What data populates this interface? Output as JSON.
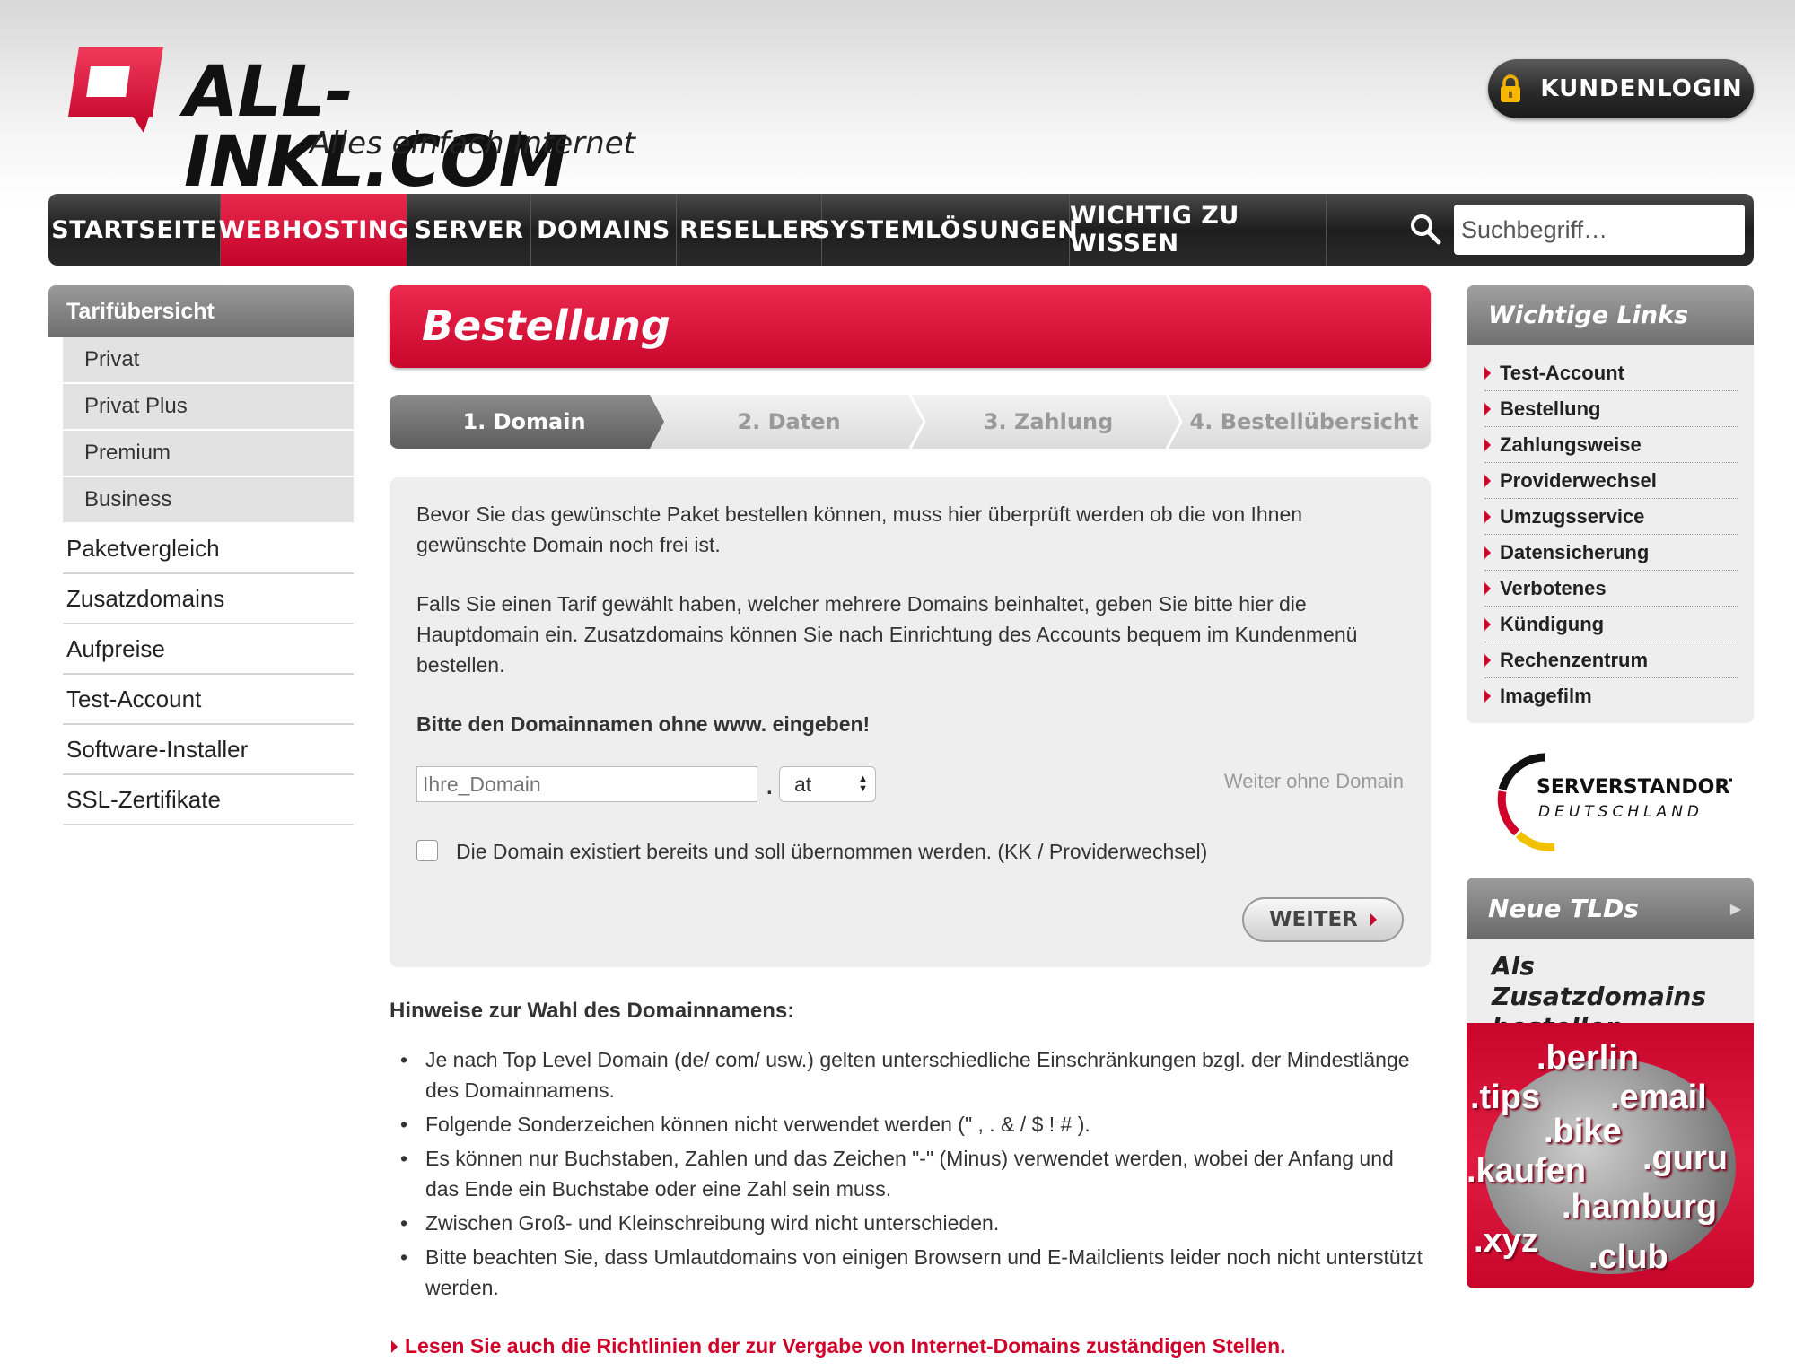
{
  "header": {
    "logo_text": "ALL-INKL.COM",
    "slogan": "Alles einfach Internet",
    "login_label": "KUNDENLOGIN",
    "accent": "#d0022a"
  },
  "nav": {
    "items": [
      "STARTSEITE",
      "WEBHOSTING",
      "SERVER",
      "DOMAINS",
      "RESELLER",
      "SYSTEMLÖSUNGEN",
      "WICHTIG ZU WISSEN"
    ],
    "active": "WEBHOSTING",
    "search_placeholder": "Suchbegriff…"
  },
  "left_sidebar": {
    "title": "Tarifübersicht",
    "sub_items": [
      "Privat",
      "Privat Plus",
      "Premium",
      "Business"
    ],
    "items": [
      "Paketvergleich",
      "Zusatzdomains",
      "Aufpreise",
      "Test-Account",
      "Software-Installer",
      "SSL-Zertifikate"
    ]
  },
  "main": {
    "title": "Bestellung",
    "steps": [
      "1. Domain",
      "2. Daten",
      "3. Zahlung",
      "4. Bestellübersicht"
    ],
    "active_step": 0,
    "intro_1": "Bevor Sie das gewünschte Paket bestellen können, muss hier überprüft werden ob die von Ihnen gewünschte Domain noch frei ist.",
    "intro_2": "Falls Sie einen Tarif gewählt haben, welcher mehrere Domains beinhaltet, geben Sie bitte hier die Hauptdomain ein. Zusatzdomains können Sie nach Einrichtung des Accounts bequem im Kundenmenü bestellen.",
    "instruction": "Bitte den Domainnamen ohne www. eingeben!",
    "domain_placeholder": "Ihre_Domain",
    "dot": ".",
    "tld_selected": "at",
    "skip_link": "Weiter ohne Domain",
    "checkbox_label": "Die Domain existiert bereits und soll übernommen werden. (KK / Providerwechsel)",
    "button_label": "WEITER",
    "hints_title": "Hinweise zur Wahl des Domainnamens:",
    "hints": [
      "Je nach Top Level Domain (de/ com/ usw.) gelten unterschiedliche Einschränkungen bzgl. der Mindestlänge des Domainnamens.",
      "Folgende Sonderzeichen können nicht verwendet werden (\" , . & / $ ! # ).",
      "Es können nur Buchstaben, Zahlen und das Zeichen \"-\" (Minus) verwendet werden, wobei der Anfang und das Ende ein Buchstabe oder eine Zahl sein muss.",
      "Zwischen Groß- und Kleinschreibung wird nicht unterschieden.",
      "Bitte beachten Sie, dass Umlautdomains von einigen Browsern und E-Mailclients leider noch nicht unterstützt werden."
    ],
    "guidelines_link": "Lesen Sie auch die Richtlinien der zur Vergabe von Internet-Domains zuständigen Stellen."
  },
  "right_sidebar": {
    "title": "Wichtige Links",
    "links": [
      "Test-Account",
      "Bestellung",
      "Zahlungsweise",
      "Providerwechsel",
      "Umzugsservice",
      "Datensicherung",
      "Verbotenes",
      "Kündigung",
      "Rechenzentrum",
      "Imagefilm"
    ],
    "badge_line1": "SERVERSTANDORT",
    "badge_line2": "DEUTSCHLAND",
    "tld_title": "Neue TLDs",
    "tld_sub": "Als Zusatzdomains bestellen",
    "tld_words": [
      ".berlin",
      ".tips",
      ".email",
      ".bike",
      ".kaufen",
      ".guru",
      ".hamburg",
      ".xyz",
      ".club"
    ]
  }
}
